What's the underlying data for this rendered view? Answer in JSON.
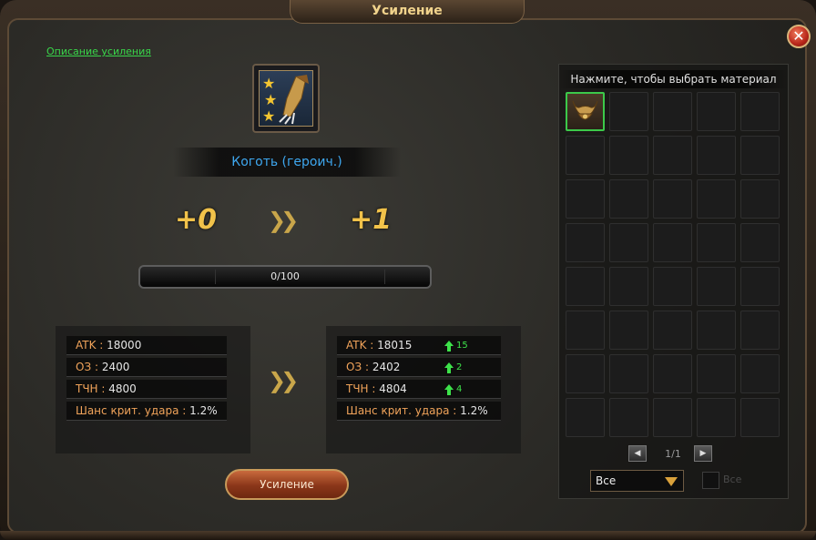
{
  "window": {
    "title": "Усиление",
    "close_icon": "close-icon"
  },
  "description_link": "Описание усиления",
  "item": {
    "name": "Коготь (героич.)",
    "stars": 3,
    "icon": "claw-icon"
  },
  "levels": {
    "current": "+0",
    "next": "+1"
  },
  "progress": {
    "text": "0/100",
    "value": 0,
    "max": 100
  },
  "stats_current": [
    {
      "label": "ATK",
      "value": "18000"
    },
    {
      "label": "ОЗ",
      "value": "2400"
    },
    {
      "label": "ТЧН",
      "value": "4800"
    },
    {
      "label": "Шанс крит. удара",
      "value": "1.2%"
    }
  ],
  "stats_next": [
    {
      "label": "ATK",
      "value": "18015",
      "increase": "15"
    },
    {
      "label": "ОЗ",
      "value": "2402",
      "increase": "2"
    },
    {
      "label": "ТЧН",
      "value": "4804",
      "increase": "4"
    },
    {
      "label": "Шанс крит. удара",
      "value": "1.2%",
      "increase": ""
    }
  ],
  "enhance_button": "Усиление",
  "materials": {
    "header": "Нажмите, чтобы выбрать материал",
    "rows": 8,
    "cols": 5,
    "filled_slots": [
      {
        "index": 0,
        "icon": "horned-helmet-icon"
      }
    ],
    "page": "1/1",
    "filter_selected": "Все",
    "checkbox_label": "Все"
  }
}
